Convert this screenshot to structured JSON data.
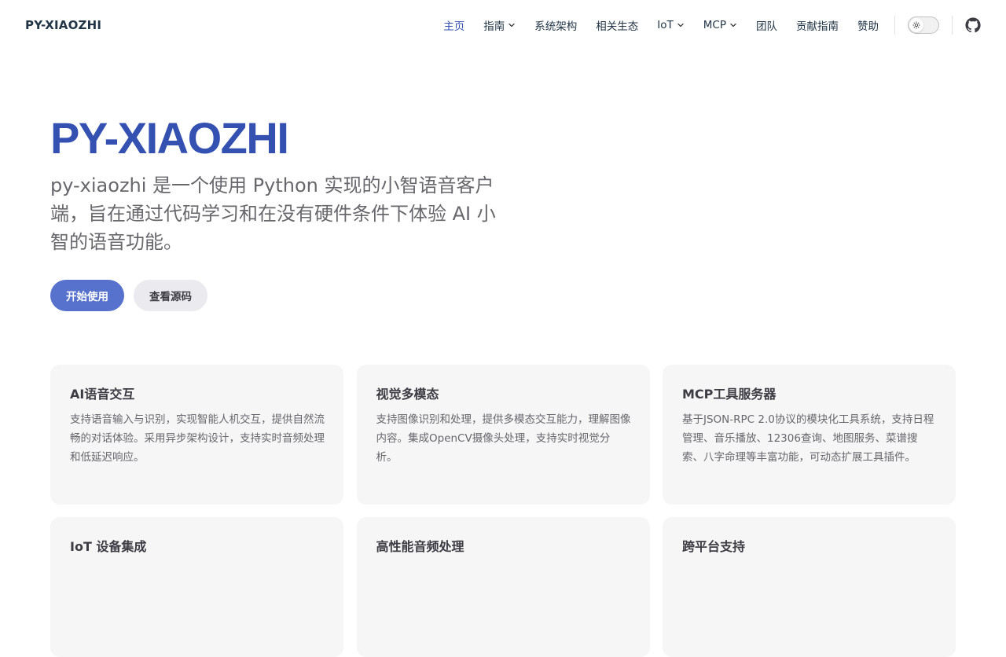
{
  "site": {
    "title": "PY-XIAOZHI"
  },
  "nav": {
    "items": [
      {
        "label": "主页",
        "active": true,
        "dropdown": false
      },
      {
        "label": "指南",
        "active": false,
        "dropdown": true
      },
      {
        "label": "系统架构",
        "active": false,
        "dropdown": false
      },
      {
        "label": "相关生态",
        "active": false,
        "dropdown": false
      },
      {
        "label": "IoT",
        "active": false,
        "dropdown": true
      },
      {
        "label": "MCP",
        "active": false,
        "dropdown": true
      },
      {
        "label": "团队",
        "active": false,
        "dropdown": false
      },
      {
        "label": "贡献指南",
        "active": false,
        "dropdown": false
      },
      {
        "label": "赞助",
        "active": false,
        "dropdown": false
      }
    ],
    "theme_toggle_icon": "sun-icon",
    "social_icon": "github-icon"
  },
  "hero": {
    "name": "PY-XIAOZHI",
    "tagline": "py-xiaozhi 是一个使用 Python 实现的小智语音客户端，旨在通过代码学习和在没有硬件条件下体验 AI 小智的语音功能。",
    "actions": [
      {
        "label": "开始使用",
        "theme": "brand"
      },
      {
        "label": "查看源码",
        "theme": "alt"
      }
    ]
  },
  "features": [
    {
      "title": "AI语音交互",
      "details": "支持语音输入与识别，实现智能人机交互，提供自然流畅的对话体验。采用异步架构设计，支持实时音频处理和低延迟响应。"
    },
    {
      "title": "视觉多模态",
      "details": "支持图像识别和处理，提供多模态交互能力，理解图像内容。集成OpenCV摄像头处理，支持实时视觉分析。"
    },
    {
      "title": "MCP工具服务器",
      "details": "基于JSON-RPC 2.0协议的模块化工具系统，支持日程管理、音乐播放、12306查询、地图服务、菜谱搜索、八字命理等丰富功能，可动态扩展工具插件。"
    },
    {
      "title": "IoT 设备集成",
      "details": ""
    },
    {
      "title": "高性能音频处理",
      "details": ""
    },
    {
      "title": "跨平台支持",
      "details": ""
    }
  ],
  "colors": {
    "brand": "#3451b2",
    "button_brand": "#5672cd",
    "card_bg": "#f6f6f7"
  }
}
